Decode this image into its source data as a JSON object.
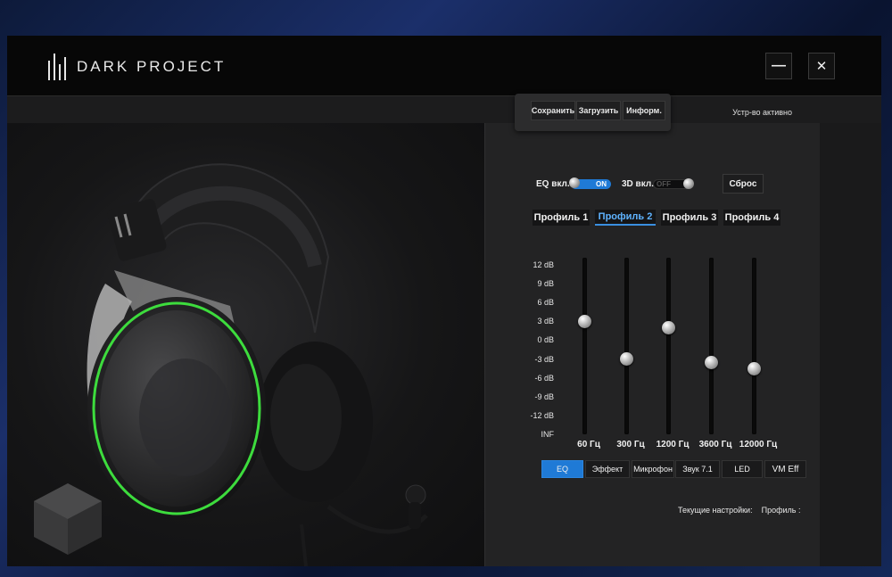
{
  "app": {
    "brand": "DARK PROJECT"
  },
  "window_controls": {
    "minimize": "—",
    "close": "✕"
  },
  "status": {
    "text": "Устр-во активно"
  },
  "menu": {
    "items": [
      "Сохранить",
      "Загрузить",
      "Информ."
    ]
  },
  "toggles": {
    "eq": {
      "label": "EQ вкл.",
      "state": "ON"
    },
    "surround": {
      "label": "3D вкл.",
      "state": "OFF"
    }
  },
  "reset_label": "Сброс",
  "profiles": [
    "Профиль 1",
    "Профиль 2",
    "Профиль 3",
    "Профиль 4"
  ],
  "active_profile": "Профиль 2",
  "eq": {
    "db_labels": [
      "12 dB",
      "9 dB",
      "6 dB",
      "3 dB",
      "0 dB",
      "-3 dB",
      "-6 dB",
      "-9 dB",
      "-12 dB",
      "INF"
    ],
    "bands": [
      {
        "freq": "60 Гц",
        "gain_db": 3
      },
      {
        "freq": "300 Гц",
        "gain_db": -3
      },
      {
        "freq": "1200 Гц",
        "gain_db": 2
      },
      {
        "freq": "3600 Гц",
        "gain_db": -3.5
      },
      {
        "freq": "12000 Гц",
        "gain_db": -4.5
      }
    ]
  },
  "effect_tabs": [
    "EQ",
    "Эффект",
    "Микрофон",
    "Звук 7.1",
    "LED",
    "VM Eff"
  ],
  "active_effect_tab": "EQ",
  "current_settings": {
    "label": "Текущие настройки:",
    "value": "Профиль :"
  },
  "colors": {
    "accent": "#1f7ad6",
    "led_ring": "#3ddc3d",
    "window_bg": "#0c0c0d"
  }
}
